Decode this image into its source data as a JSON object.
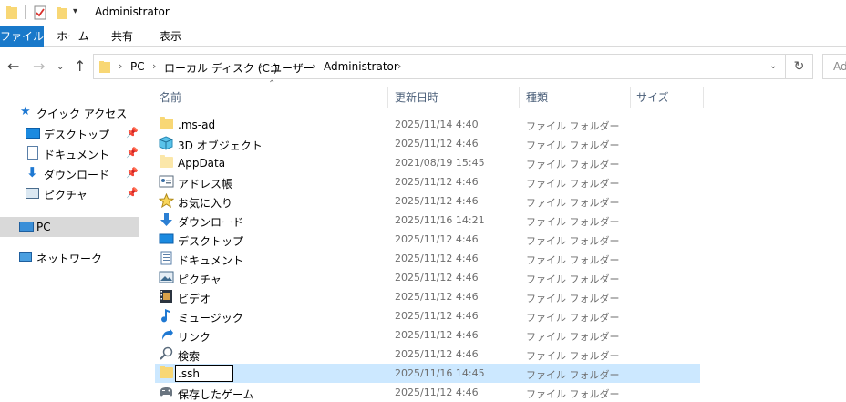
{
  "window": {
    "title": "Administrator"
  },
  "ribbon": {
    "tabs": [
      "ファイル",
      "ホーム",
      "共有",
      "表示"
    ]
  },
  "address": {
    "crumbs": [
      "PC",
      "ローカル ディスク (C:)",
      "ユーザー",
      "Administrator"
    ],
    "search_placeholder": "Ad"
  },
  "nav": {
    "quick_access": "クイック アクセス",
    "pinned": [
      "デスクトップ",
      "ドキュメント",
      "ダウンロード",
      "ピクチャ"
    ],
    "pc": "PC",
    "network": "ネットワーク"
  },
  "columns": {
    "name": "名前",
    "date": "更新日時",
    "type": "種類",
    "size": "サイズ"
  },
  "files": [
    {
      "name": ".ms-ad",
      "date": "2025/11/14 4:40",
      "type": "ファイル フォルダー",
      "icon": "folder-icon"
    },
    {
      "name": "3D オブジェクト",
      "date": "2025/11/12 4:46",
      "type": "ファイル フォルダー",
      "icon": "3d-objects-icon"
    },
    {
      "name": "AppData",
      "date": "2021/08/19 15:45",
      "type": "ファイル フォルダー",
      "icon": "folder-hidden-icon"
    },
    {
      "name": "アドレス帳",
      "date": "2025/11/12 4:46",
      "type": "ファイル フォルダー",
      "icon": "contacts-icon"
    },
    {
      "name": "お気に入り",
      "date": "2025/11/12 4:46",
      "type": "ファイル フォルダー",
      "icon": "favorites-star-icon"
    },
    {
      "name": "ダウンロード",
      "date": "2025/11/16 14:21",
      "type": "ファイル フォルダー",
      "icon": "download-arrow-icon"
    },
    {
      "name": "デスクトップ",
      "date": "2025/11/12 4:46",
      "type": "ファイル フォルダー",
      "icon": "desktop-icon"
    },
    {
      "name": "ドキュメント",
      "date": "2025/11/12 4:46",
      "type": "ファイル フォルダー",
      "icon": "documents-icon"
    },
    {
      "name": "ピクチャ",
      "date": "2025/11/12 4:46",
      "type": "ファイル フォルダー",
      "icon": "pictures-icon"
    },
    {
      "name": "ビデオ",
      "date": "2025/11/12 4:46",
      "type": "ファイル フォルダー",
      "icon": "videos-icon"
    },
    {
      "name": "ミュージック",
      "date": "2025/11/12 4:46",
      "type": "ファイル フォルダー",
      "icon": "music-note-icon"
    },
    {
      "name": "リンク",
      "date": "2025/11/12 4:46",
      "type": "ファイル フォルダー",
      "icon": "links-arrow-icon"
    },
    {
      "name": "検索",
      "date": "2025/11/12 4:46",
      "type": "ファイル フォルダー",
      "icon": "search-icon"
    },
    {
      "name": ".ssh",
      "date": "2025/11/16 14:45",
      "type": "ファイル フォルダー",
      "icon": "folder-icon"
    },
    {
      "name": "保存したゲーム",
      "date": "2025/11/12 4:46",
      "type": "ファイル フォルダー",
      "icon": "saved-games-icon"
    }
  ],
  "selected_index": 13,
  "rename_value": ".ssh",
  "colors": {
    "accent": "#1979ca",
    "selection": "#cce8ff",
    "folder": "#f8d775"
  }
}
